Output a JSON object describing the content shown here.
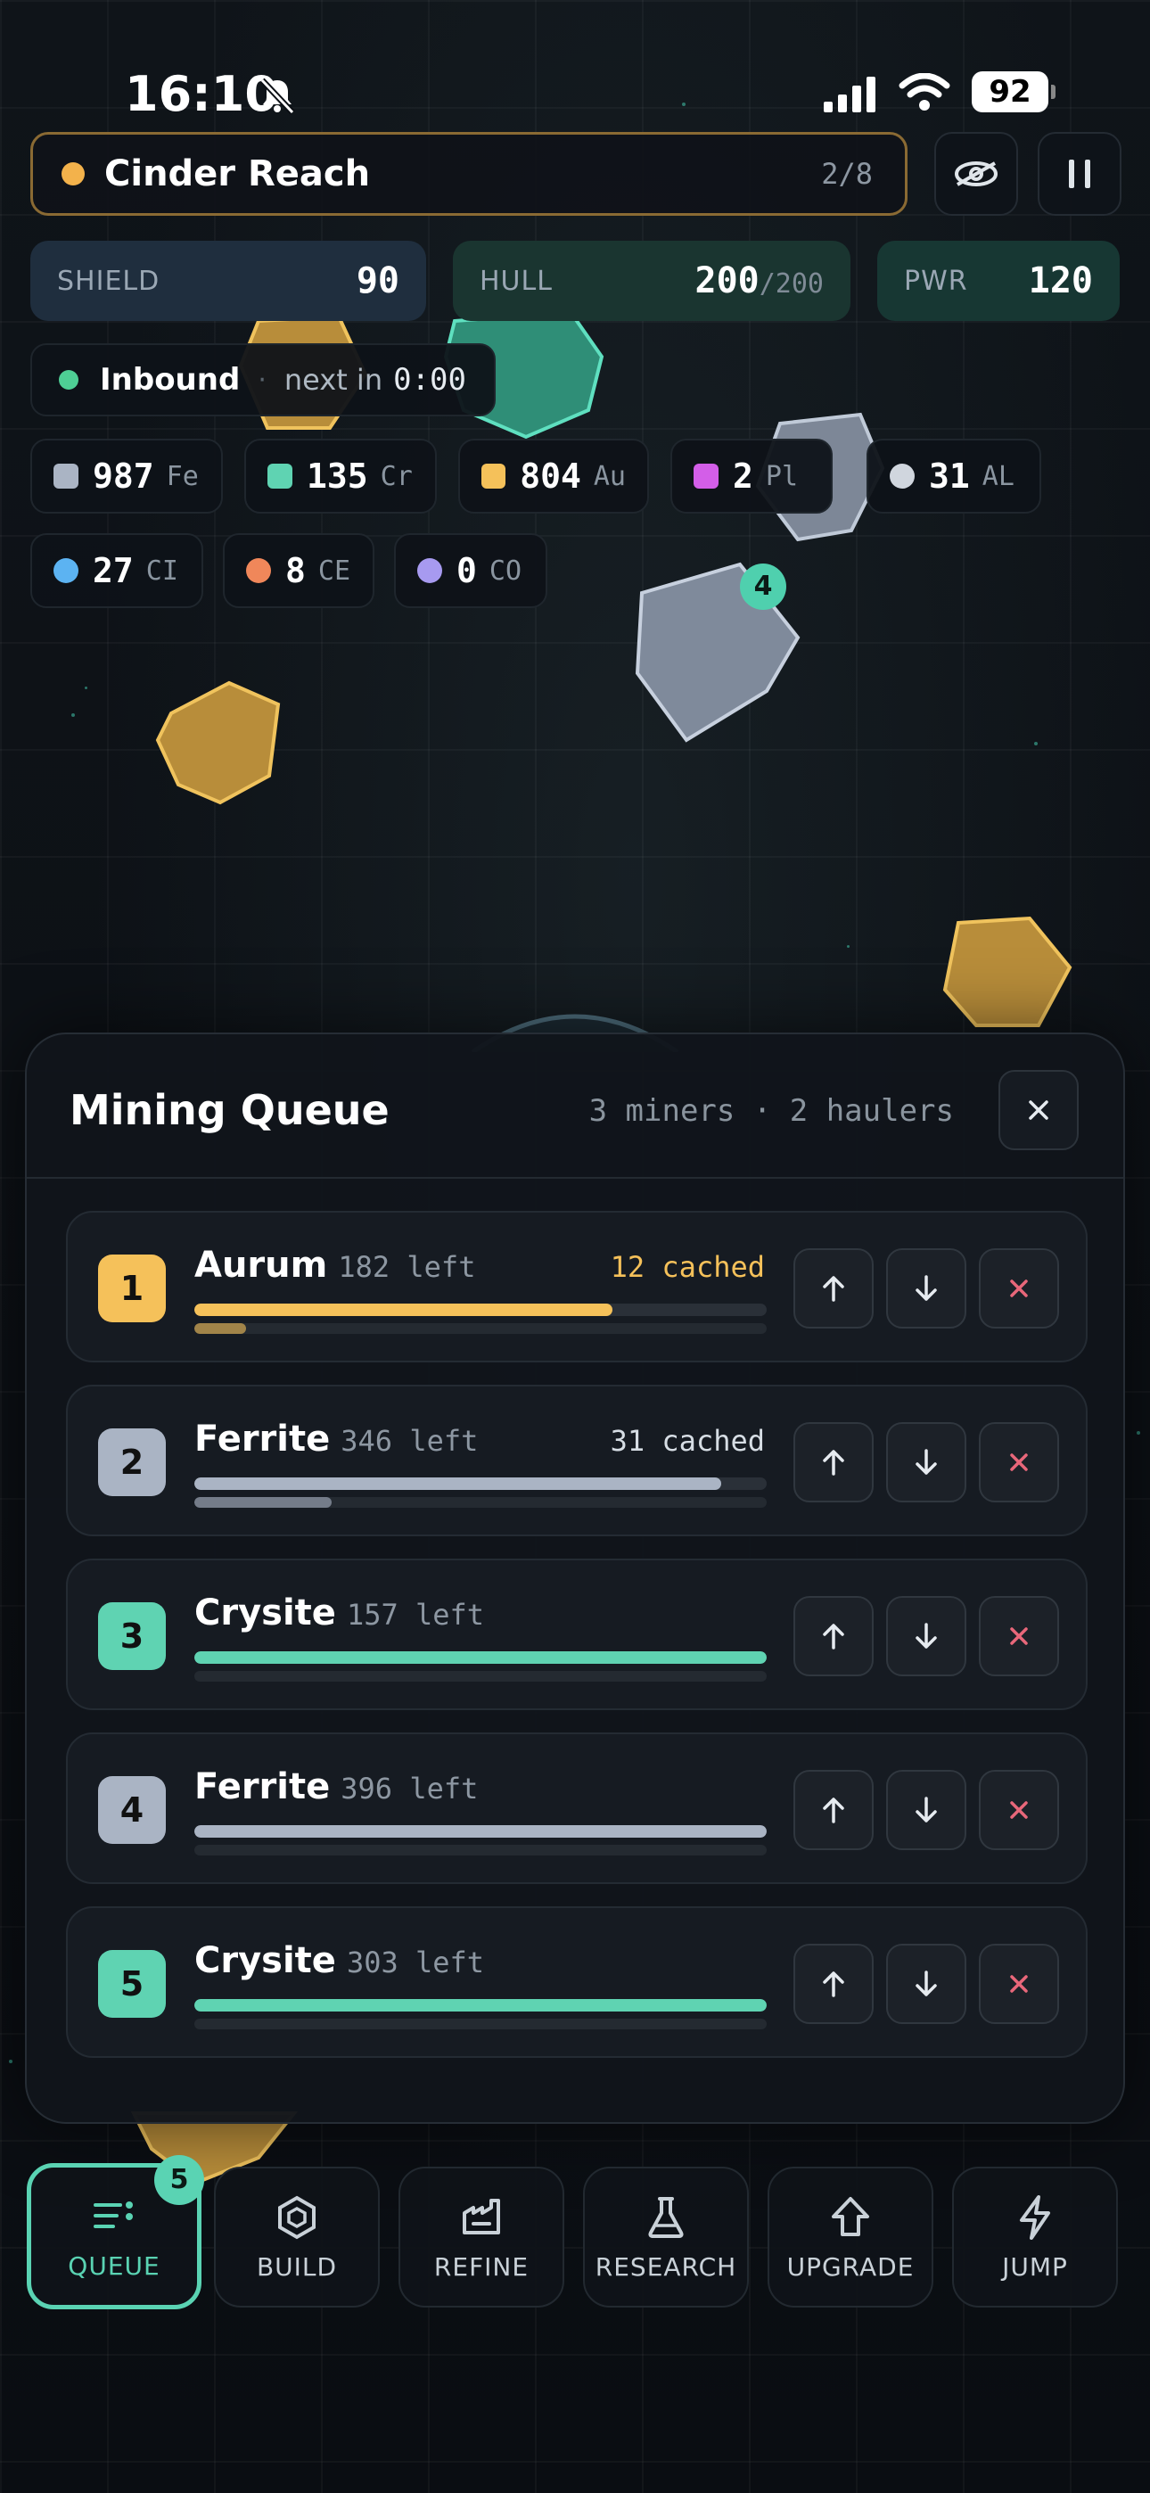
{
  "status_bar": {
    "time": "16:10",
    "battery": "92"
  },
  "location": {
    "name": "Cinder Reach",
    "progress": "2/8",
    "accent": "#f3b24b"
  },
  "hud_buttons": {
    "view_icon": "eye-icon",
    "pause_icon": "pause-icon"
  },
  "stats": {
    "shield": {
      "label": "SHIELD",
      "value": "90"
    },
    "hull": {
      "label": "HULL",
      "value": "200",
      "max": "/200"
    },
    "power": {
      "label": "PWR",
      "value": "120"
    }
  },
  "inbound": {
    "label": "Inbound",
    "text": "next in",
    "timer": "0:00"
  },
  "resources": [
    {
      "amount": "987",
      "code": "Fe",
      "color": "#aab4c4"
    },
    {
      "amount": "135",
      "code": "Cr",
      "color": "#5fd3b2"
    },
    {
      "amount": "804",
      "code": "Au",
      "color": "#f5c15a"
    },
    {
      "amount": "2",
      "code": "Pl",
      "color": "#d35ee8"
    },
    {
      "amount": "31",
      "code": "AL",
      "color": "#d0d6de"
    },
    {
      "amount": "27",
      "code": "CI",
      "color": "#5cb3f2"
    },
    {
      "amount": "8",
      "code": "CE",
      "color": "#f0875a"
    },
    {
      "amount": "0",
      "code": "CO",
      "color": "#a79af0"
    }
  ],
  "asteroid_badge": "4",
  "queue": {
    "title": "Mining Queue",
    "meta": "3 miners · 2 haulers",
    "items": [
      {
        "num": "1",
        "name": "Aurum",
        "left": "182 left",
        "cached": "12 cached",
        "color": "#f5c15a",
        "progress": 0.73,
        "cached_progress": 0.09
      },
      {
        "num": "2",
        "name": "Ferrite",
        "left": "346 left",
        "cached": "31 cached",
        "color": "#aab4c4",
        "progress": 0.92,
        "cached_progress": 0.24
      },
      {
        "num": "3",
        "name": "Crysite",
        "left": "157 left",
        "cached": "",
        "color": "#5fd3b2",
        "progress": 1.0,
        "cached_progress": 0
      },
      {
        "num": "4",
        "name": "Ferrite",
        "left": "396 left",
        "cached": "",
        "color": "#aab4c4",
        "progress": 1.0,
        "cached_progress": 0
      },
      {
        "num": "5",
        "name": "Crysite",
        "left": "303 left",
        "cached": "",
        "color": "#5fd3b2",
        "progress": 1.0,
        "cached_progress": 0
      }
    ]
  },
  "tabs": [
    {
      "label": "QUEUE",
      "icon": "queue-icon",
      "badge": "5",
      "active": true
    },
    {
      "label": "BUILD",
      "icon": "hexagon-icon"
    },
    {
      "label": "REFINE",
      "icon": "refinery-icon"
    },
    {
      "label": "RESEARCH",
      "icon": "flask-icon"
    },
    {
      "label": "UPGRADE",
      "icon": "arrow-up-icon"
    },
    {
      "label": "JUMP",
      "icon": "lightning-icon"
    }
  ]
}
